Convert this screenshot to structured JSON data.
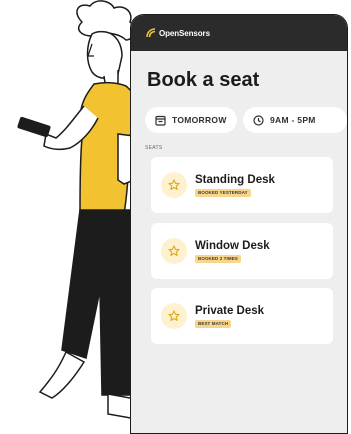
{
  "app": {
    "brand": "OpenSensors"
  },
  "page": {
    "title": "Book a seat"
  },
  "filters": {
    "date": "TOMORROW",
    "time": "9AM - 5PM"
  },
  "section": {
    "label": "SEATS"
  },
  "seats": [
    {
      "name": "Standing Desk",
      "badge": "BOOKED YESTERDAY"
    },
    {
      "name": "Window Desk",
      "badge": "BOOKED 2 TIMES"
    },
    {
      "name": "Private Desk",
      "badge": "BEST MATCH"
    }
  ],
  "colors": {
    "header_bg": "#2b2b2b",
    "screen_bg": "#eeeeee",
    "accent_yellow": "#f2c230",
    "badge_bg": "#f7d58a",
    "star_bg": "#fdf1cf",
    "pants": "#1c1c1c"
  },
  "icons": {
    "logo": "signal-arc-logo",
    "calendar": "calendar-icon",
    "clock": "clock-icon",
    "star": "star-icon"
  }
}
